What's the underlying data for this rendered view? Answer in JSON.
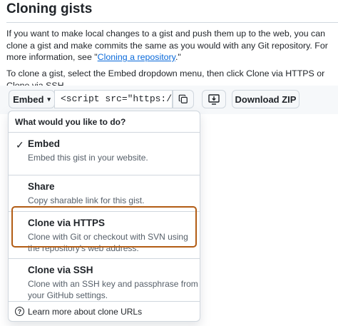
{
  "heading": "Cloning gists",
  "intro": {
    "text_before_link": "If you want to make local changes to a gist and push them up to the web, you can clone a gist and make commits the same as you would with any Git repository. For more information, see \"",
    "link_text": "Cloning a repository",
    "text_after_link": ".\""
  },
  "instruction": "To clone a gist, select the Embed dropdown menu, then click Clone via HTTPS or Clone via SSH.",
  "toolbar": {
    "embed_label": "Embed",
    "url_value": "<script src=\"https://",
    "copy_icon": "copy-icon",
    "desktop_icon": "desktop-download-icon",
    "download_zip_label": "Download ZIP"
  },
  "dropdown": {
    "header": "What would you like to do?",
    "items": [
      {
        "title": "Embed",
        "description": "Embed this gist in your website.",
        "checked": true
      },
      {
        "title": "Share",
        "description": "Copy sharable link for this gist.",
        "checked": false
      },
      {
        "title": "Clone via HTTPS",
        "description": "Clone with Git or checkout with SVN using the repository's web address.",
        "checked": false,
        "highlighted": true
      },
      {
        "title": "Clone via SSH",
        "description": "Clone with an SSH key and passphrase from your GitHub settings.",
        "checked": false
      }
    ],
    "footer_link": "Learn more about clone URLs"
  },
  "colors": {
    "link": "#0969da",
    "highlight_border": "#b25c14",
    "muted_text": "#57606a"
  }
}
